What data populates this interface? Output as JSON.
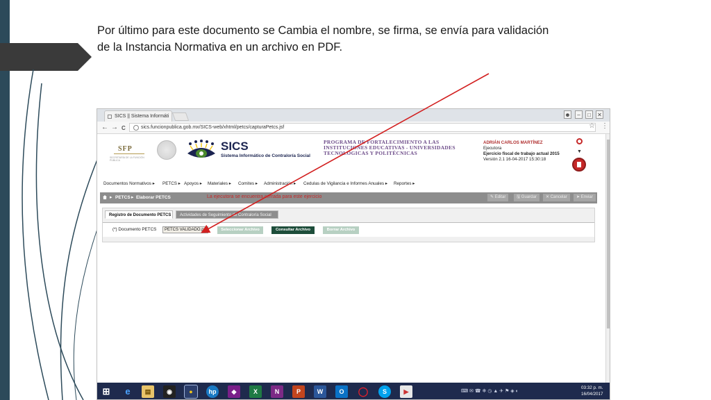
{
  "slide": {
    "caption_line1": "Por último para este documento se Cambia el nombre, se firma, se envía para validación",
    "caption_line2": "de la Instancia Normativa  en un archivo en PDF."
  },
  "browser": {
    "tab_title": "SICS || Sistema Informáti",
    "url": "sics.funcionpublica.gob.mx/SICS-web/xhtml/petcs/capturaPetcs.jsf",
    "back": "←",
    "forward": "→",
    "reload": "C",
    "bookmark_icon": "star-icon",
    "menu_icon": "kebab-icon"
  },
  "site_header": {
    "sfp_text": "SFP",
    "sfp_sub": "SECRETARÍA DE LA FUNCIÓN PÚBLICA",
    "sics_title": "SICS",
    "sics_subtitle": "Sistema Informático de Contraloría Social",
    "program_line1": "PROGRAMA DE FORTALECIMIENTO A LAS",
    "program_line2": "INSTITUCIONES EDUCATIVAS - UNIVERSIDADES",
    "program_line3": "TECNOLÓGICAS Y POLITÉCNICAS",
    "user_name": "ADRIÁN CARLOS MARTÍNEZ",
    "user_role": "Ejecutora",
    "fiscal_year": "Ejercicio fiscal de trabajo actual  2015",
    "version": "Versión 2.1   16-04-2017 15:30:18"
  },
  "menu": {
    "items": [
      "Documentos Normativos ▸",
      "PETCS ▸",
      "Apoyos ▸",
      "Materiales ▸",
      "Comites ▸",
      "Administración ▸",
      "Cedulas de Vigilancia e Informes Anuales ▸",
      "Reportes ▸"
    ]
  },
  "breadcrumb": {
    "level1": "PETCS",
    "level2": "Elaborar PETCS",
    "alert": "La ejecutora se encuentra cerrada para este ejercicio",
    "actions": [
      "✎ Editar",
      "🖫 Guardar",
      "✕ Cancelar",
      "➤ Enviar"
    ]
  },
  "panel": {
    "tab_active": "Registro de Documento PETCS",
    "tab_inactive": "Actividades de Seguimiento de Contraloría Social",
    "doc_label": "(*) Documento PETCS",
    "doc_value": "PETCS VALIDADO.pdf",
    "btn_select": "Seleccionar Archivo",
    "btn_consult": "Consultar Archivo",
    "btn_delete": "Borrar Archivo"
  },
  "taskbar": {
    "apps": [
      "⊞",
      "e",
      "▤",
      "◉",
      "●",
      "hp",
      "◆",
      "X",
      "N",
      "P",
      "W",
      "O",
      "◯",
      "S",
      "▶"
    ],
    "tray": "⌨ ✉ ☎ ❄ ◷ ▲ ✈ ⚑ ◈ ◐",
    "time": "03:32 p. m.",
    "date": "16/04/2017"
  },
  "colors": {
    "caption": "#1a1a1a",
    "sics_navy": "#1b2450",
    "program_purple": "#6e4d8a",
    "alert_red": "#c62828",
    "btn_disabled": "#b7d0c2",
    "btn_active": "#1d4d3a",
    "arrow": "#d21f1f"
  }
}
